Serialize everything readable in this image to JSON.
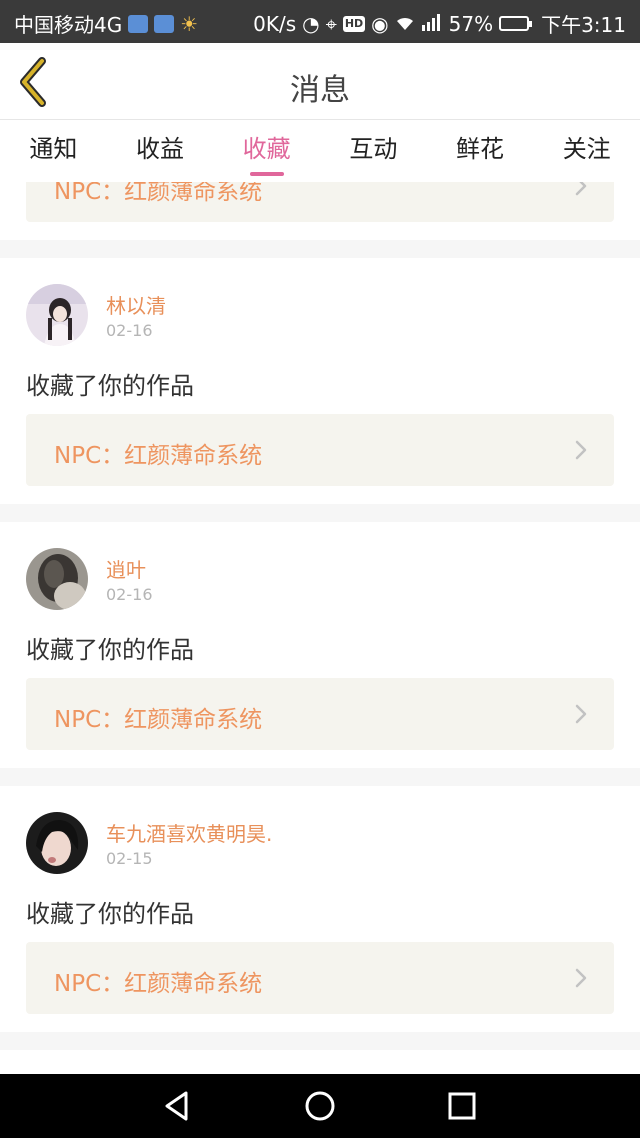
{
  "status_bar": {
    "carrier": "中国移动4G",
    "speed": "0K/s",
    "network": "4G",
    "battery": "57%",
    "time": "下午3:11"
  },
  "header": {
    "title": "消息",
    "back_icon": "chevron-left-icon",
    "accent_color": "#c8a020"
  },
  "tabs": [
    {
      "label": "通知",
      "active": false
    },
    {
      "label": "收益",
      "active": false
    },
    {
      "label": "收藏",
      "active": true
    },
    {
      "label": "互动",
      "active": false
    },
    {
      "label": "鲜花",
      "active": false
    },
    {
      "label": "关注",
      "active": false
    }
  ],
  "tab_active_color": "#e0679b",
  "partial_card": {
    "work_title": "NPC：红颜薄命系统"
  },
  "cards": [
    {
      "username": "林以清",
      "date": "02-16",
      "action": "收藏了你的作品",
      "work_title": "NPC：红颜薄命系统"
    },
    {
      "username": "逍叶",
      "date": "02-16",
      "action": "收藏了你的作品",
      "work_title": "NPC：红颜薄命系统"
    },
    {
      "username": "车九酒喜欢黄明昊.",
      "date": "02-15",
      "action": "收藏了你的作品",
      "work_title": "NPC：红颜薄命系统"
    }
  ],
  "nav_bar": {
    "back": "triangle-back-icon",
    "home": "circle-home-icon",
    "recents": "square-recents-icon"
  }
}
